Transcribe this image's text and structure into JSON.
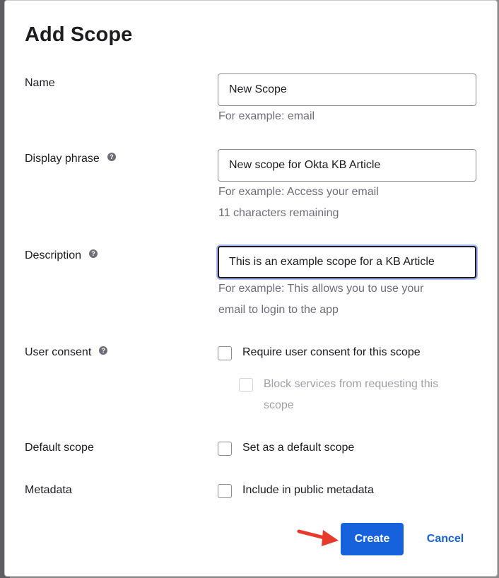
{
  "dialog": {
    "title": "Add Scope"
  },
  "form": {
    "name": {
      "label": "Name",
      "value": "New Scope",
      "hint": "For example: email"
    },
    "display_phrase": {
      "label": "Display phrase",
      "value": "New scope for Okta KB Article",
      "hint": "For example: Access your email",
      "remaining": "11 characters remaining"
    },
    "description": {
      "label": "Description",
      "value": "This is an example scope for a KB Article",
      "hint_line1": "For example: This allows you to use your",
      "hint_line2": "email to login to the app"
    },
    "user_consent": {
      "label": "User consent",
      "option": "Require user consent for this scope",
      "sub_option_line1": "Block services from requesting this",
      "sub_option_line2": "scope"
    },
    "default_scope": {
      "label": "Default scope",
      "option": "Set as a default scope"
    },
    "metadata": {
      "label": "Metadata",
      "option": "Include in public metadata"
    }
  },
  "actions": {
    "create_label": "Create",
    "cancel_label": "Cancel"
  },
  "icons": {
    "help": "help-circle-icon",
    "arrow": "arrow-right-icon"
  },
  "colors": {
    "primary": "#1662dd",
    "annotation_arrow": "#e8392d",
    "focus_ring": "#a7b9f2"
  }
}
